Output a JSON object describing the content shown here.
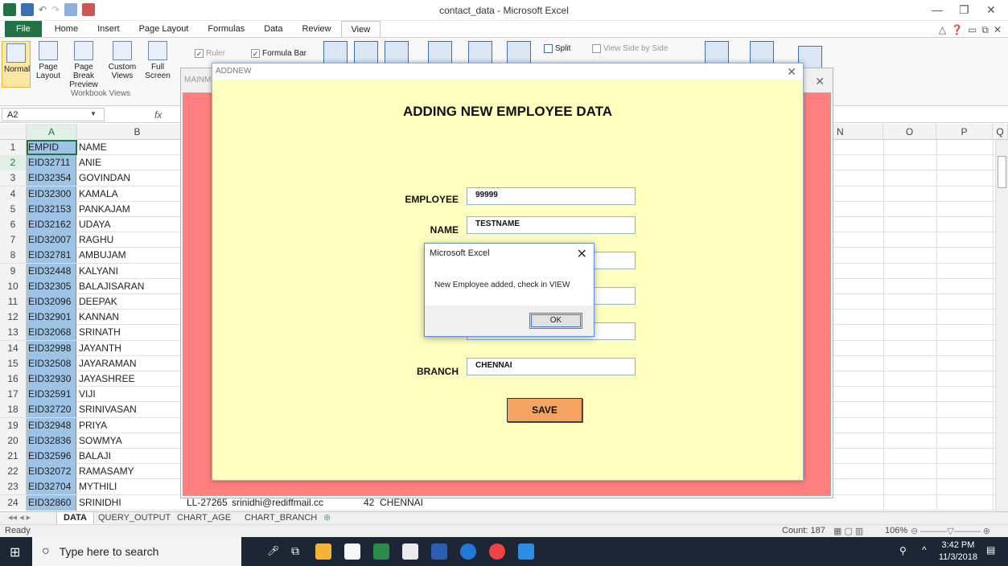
{
  "window": {
    "title": "contact_data - Microsoft Excel"
  },
  "ribbon_tabs": [
    "File",
    "Home",
    "Insert",
    "Page Layout",
    "Formulas",
    "Data",
    "Review",
    "View"
  ],
  "ribbon": {
    "normal": "Normal",
    "page_layout": "Page Layout",
    "page_break": "Page Break Preview",
    "custom_views": "Custom Views",
    "full_screen": "Full Screen",
    "group_label": "Workbook Views",
    "ruler": "Ruler",
    "formula_bar": "Formula Bar",
    "split": "Split",
    "view_side": "View Side by Side"
  },
  "formula_bar": {
    "name_box": "A2",
    "fx": "fx"
  },
  "columns": [
    "A",
    "B",
    "N",
    "O",
    "P",
    "Q"
  ],
  "rows": [
    {
      "n": "1",
      "a": "EMPID",
      "b": "NAME"
    },
    {
      "n": "2",
      "a": "EID32711",
      "b": "ANIE"
    },
    {
      "n": "3",
      "a": "EID32354",
      "b": "GOVINDAN"
    },
    {
      "n": "4",
      "a": "EID32300",
      "b": "KAMALA"
    },
    {
      "n": "5",
      "a": "EID32153",
      "b": "PANKAJAM"
    },
    {
      "n": "6",
      "a": "EID32162",
      "b": "UDAYA"
    },
    {
      "n": "7",
      "a": "EID32007",
      "b": "RAGHU"
    },
    {
      "n": "8",
      "a": "EID32781",
      "b": "AMBUJAM"
    },
    {
      "n": "9",
      "a": "EID32448",
      "b": "KALYANI"
    },
    {
      "n": "10",
      "a": "EID32305",
      "b": "BALAJISARAN"
    },
    {
      "n": "11",
      "a": "EID32096",
      "b": "DEEPAK"
    },
    {
      "n": "12",
      "a": "EID32901",
      "b": "KANNAN"
    },
    {
      "n": "13",
      "a": "EID32068",
      "b": "SRINATH"
    },
    {
      "n": "14",
      "a": "EID32998",
      "b": "JAYANTH"
    },
    {
      "n": "15",
      "a": "EID32508",
      "b": "JAYARAMAN"
    },
    {
      "n": "16",
      "a": "EID32930",
      "b": "JAYASHREE"
    },
    {
      "n": "17",
      "a": "EID32591",
      "b": "VIJI"
    },
    {
      "n": "18",
      "a": "EID32720",
      "b": "SRINIVASAN"
    },
    {
      "n": "19",
      "a": "EID32948",
      "b": "PRIYA"
    },
    {
      "n": "20",
      "a": "EID32836",
      "b": "SOWMYA"
    },
    {
      "n": "21",
      "a": "EID32596",
      "b": "BALAJI"
    },
    {
      "n": "22",
      "a": "EID32072",
      "b": "RAMASAMY"
    },
    {
      "n": "23",
      "a": "EID32704",
      "b": "MYTHILI"
    },
    {
      "n": "24",
      "a": "EID32860",
      "b": "SRINIDHI"
    }
  ],
  "row24_extra": {
    "c": "LL-27265",
    "email": "srinidhi@rediffmail.cc",
    "age": "42",
    "branch": "CHENNAI"
  },
  "sheet_tabs": [
    "DATA",
    "QUERY_OUTPUT",
    "CHART_AGE",
    "CHART_BRANCH"
  ],
  "status": {
    "ready": "Ready",
    "count": "Count: 187",
    "zoom": "106%"
  },
  "taskbar": {
    "search_placeholder": "Type here to search",
    "time": "3:42 PM",
    "date": "11/3/2018"
  },
  "main_form": {
    "title": "MAINM"
  },
  "add_form": {
    "title": "ADDNEW",
    "heading": "ADDING NEW EMPLOYEE DATA",
    "employee_label": "EMPLOYEE",
    "employee_value": "99999",
    "name_label": "NAME",
    "name_value": "TESTNAME",
    "branch_label": "BRANCH",
    "branch_value": "CHENNAI",
    "save": "SAVE"
  },
  "msgbox": {
    "title": "Microsoft Excel",
    "message": "New Employee added, check in VIEW",
    "ok": "OK"
  },
  "colors": {
    "excel_green": "#217346",
    "form_bg": "#ffffc0",
    "main_bg": "#ff7f7f",
    "save_bg": "#f4a460"
  }
}
